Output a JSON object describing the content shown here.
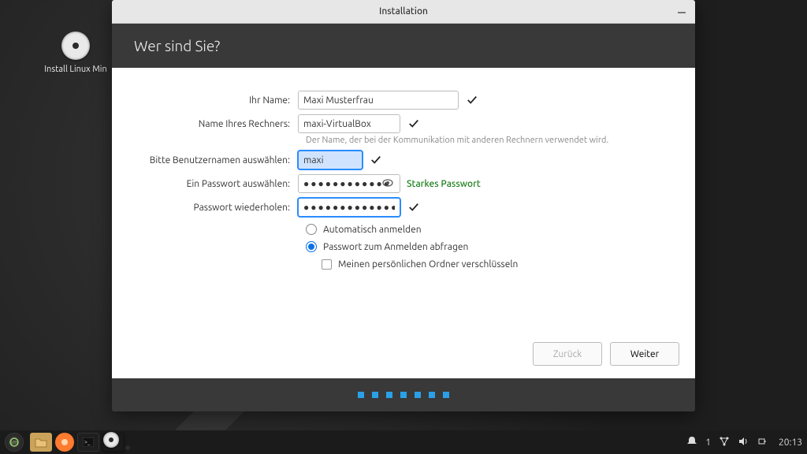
{
  "desktop": {
    "icon_label": "Install Linux Min"
  },
  "window": {
    "title": "Installation",
    "heading": "Wer sind Sie?"
  },
  "form": {
    "name_label": "Ihr Name:",
    "name_value": "Maxi Musterfrau",
    "host_label": "Name Ihres Rechners:",
    "host_value": "maxi-VirtualBox",
    "host_hint": "Der Name, der bei der Kommunikation mit anderen Rechnern verwendet wird.",
    "user_label": "Bitte Benutzernamen auswählen:",
    "user_value": "maxi",
    "pwd_label": "Ein Passwort auswählen:",
    "pwd_value": "●●●●●●●●●●●●",
    "pwd_strength": "Starkes Passwort",
    "pwd2_label": "Passwort wiederholen:",
    "pwd2_value": "●●●●●●●●●●●●●",
    "auto_login_label": "Automatisch anmelden",
    "require_pwd_label": "Passwort zum Anmelden abfragen",
    "encrypt_label": "Meinen persönlichen Ordner verschlüsseln"
  },
  "buttons": {
    "back": "Zurück",
    "next": "Weiter"
  },
  "tray": {
    "count": "1",
    "time": "20:13"
  }
}
